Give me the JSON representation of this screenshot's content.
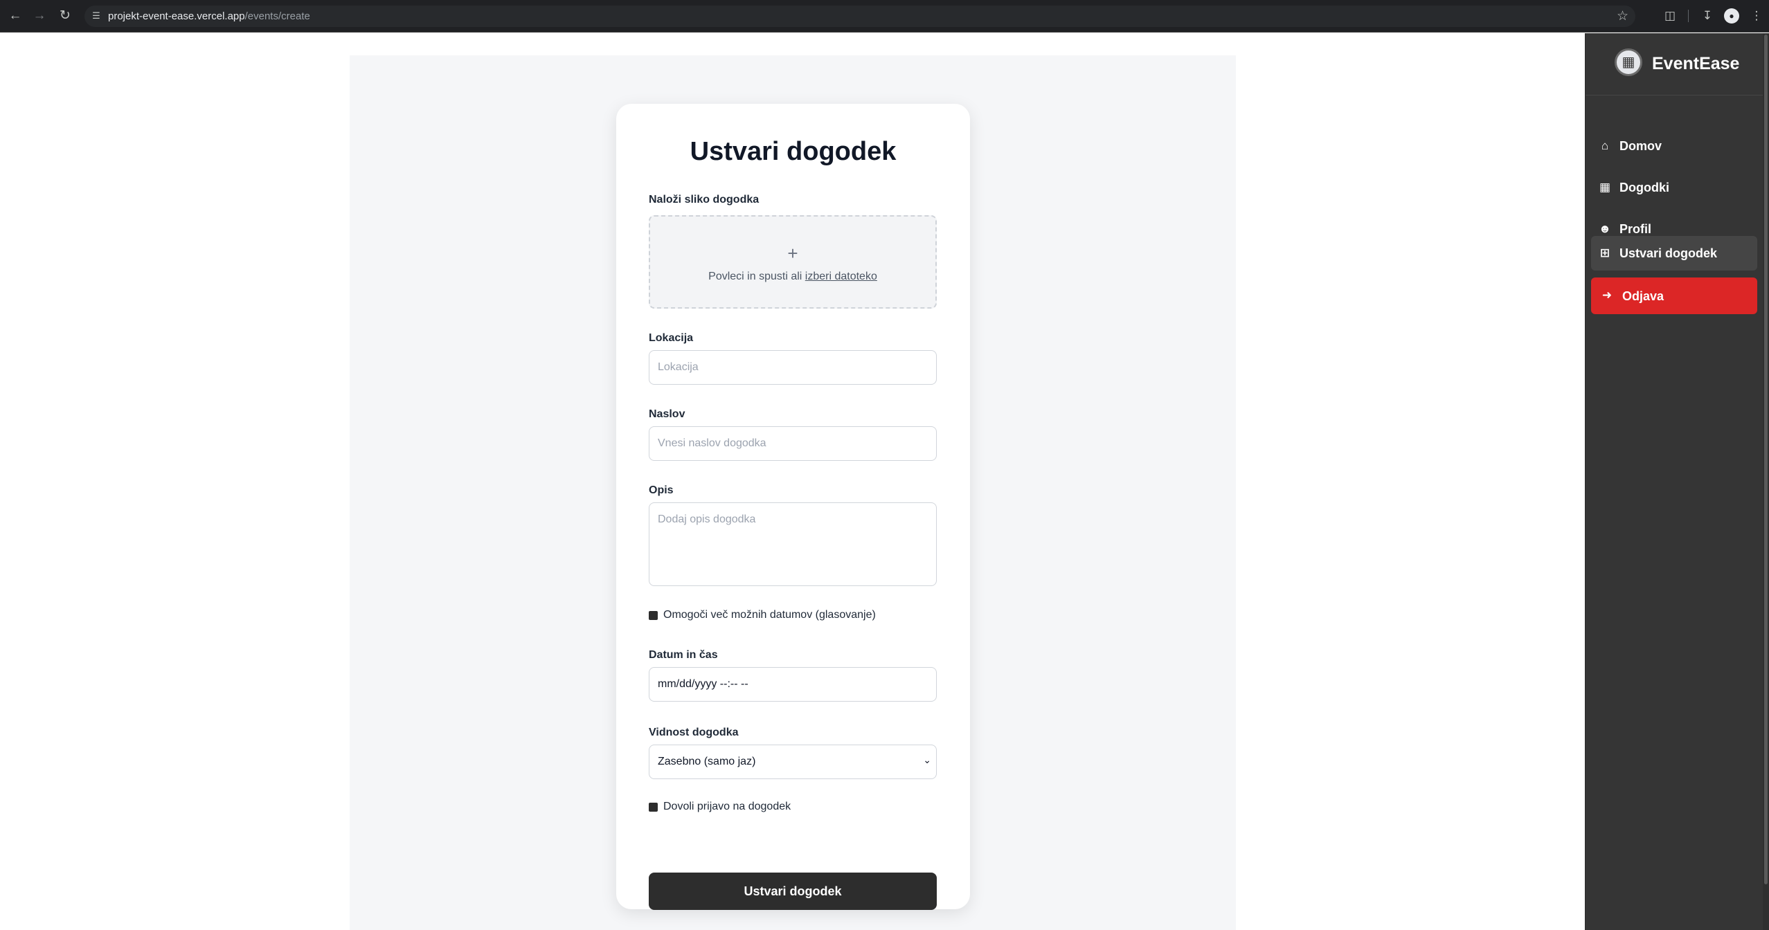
{
  "browser": {
    "url_host": "projekt-event-ease.vercel.app",
    "url_path": "/events/create"
  },
  "sidebar": {
    "brand": "EventEase",
    "items": [
      {
        "label": "Domov",
        "icon": "home-icon"
      },
      {
        "label": "Dogodki",
        "icon": "calendar-icon"
      },
      {
        "label": "Profil",
        "icon": "user-icon"
      },
      {
        "label": "Ustvari dogodek",
        "icon": "plus-square-icon"
      },
      {
        "label": "Odjava",
        "icon": "logout-icon"
      }
    ],
    "active": "Ustvari dogodek",
    "logout_color": "#dc2626"
  },
  "form": {
    "title": "Ustvari dogodek",
    "image": {
      "label": "Naloži sliko dogodka",
      "plus": "+",
      "text": "Povleci in spusti ali",
      "link": "izberi datoteko"
    },
    "location": {
      "label": "Lokacija",
      "placeholder": "Lokacija"
    },
    "title_field": {
      "label": "Naslov",
      "placeholder": "Vnesi naslov dogodka"
    },
    "description": {
      "label": "Opis",
      "placeholder": "Dodaj opis dogodka"
    },
    "multi_dates": {
      "label": "Omogoči več možnih datumov (glasovanje)"
    },
    "datetime": {
      "label": "Datum in čas",
      "value": "mm/dd/yyyy  --:--  --"
    },
    "visibility": {
      "label": "Vidnost dogodka",
      "selected": "Zasebno (samo jaz)"
    },
    "allow_signup": {
      "label": "Dovoli prijavo na dogodek"
    },
    "submit": "Ustvari dogodek"
  },
  "colors": {
    "sidebar_bg": "#353535",
    "primary_button": "#2d2d2d",
    "danger": "#dc2626",
    "content_bg": "#f5f6f8"
  }
}
